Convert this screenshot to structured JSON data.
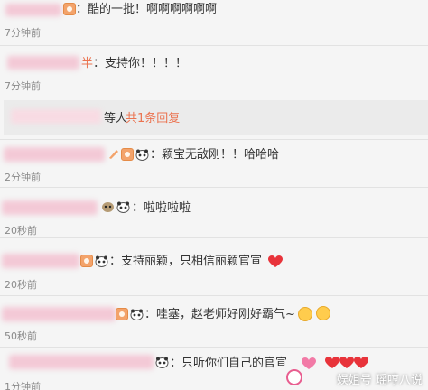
{
  "comments": [
    {
      "text": "：酷的一批！啊啊啊啊啊啊",
      "time": "7分钟前"
    },
    {
      "name_fragment": "半",
      "text": "：支持你！！！！",
      "time": "7分钟前"
    },
    {
      "text": "：颖宝无敌刚！！哈哈哈",
      "time": "2分钟前"
    },
    {
      "text": "：啦啦啦啦",
      "time": "20秒前"
    },
    {
      "text": "：支持丽颖，只相信丽颖官宣",
      "time": "20秒前"
    },
    {
      "text": "：哇塞，赵老师好刚好霸气~",
      "time": "50秒前"
    },
    {
      "text": "：只听你们自己的官宣",
      "time": "1分钟前"
    }
  ],
  "reply_bar": {
    "name_fragment": "等人",
    "link": "共1条回复"
  },
  "watermark": "娱姐号 瑶哼八说",
  "colors": {
    "reply_link": "#eb7350",
    "time": "#8a8a8a",
    "heart": "#e8333a"
  },
  "icons": [
    "vip-badge-icon",
    "panda-emoji-icon",
    "heart-icon",
    "laughing-emoji-icon",
    "kiss-emoji-icon"
  ]
}
